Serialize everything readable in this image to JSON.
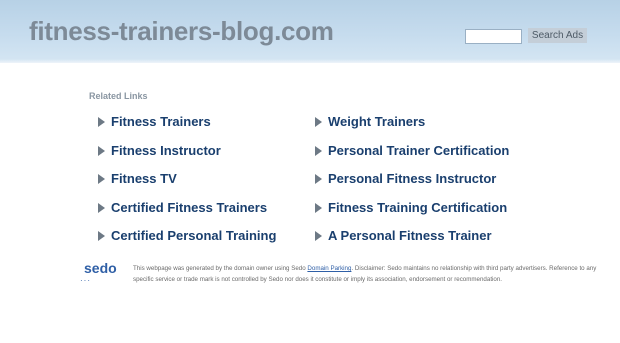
{
  "header": {
    "site_title": "fitness-trainers-blog.com",
    "search_placeholder": "",
    "search_button": "Search Ads"
  },
  "related": {
    "heading": "Related Links",
    "left": [
      "Fitness Trainers",
      "Fitness Instructor",
      "Fitness TV",
      "Certified Fitness Trainers",
      "Certified Personal Training"
    ],
    "right": [
      "Weight Trainers",
      "Personal Trainer Certification",
      "Personal Fitness Instructor",
      "Fitness Training Certification",
      "A Personal Fitness Trainer"
    ]
  },
  "footer": {
    "logo_text": "sedo",
    "disclaimer_before": "This webpage was generated by the domain owner using Sedo ",
    "disclaimer_link": "Domain Parking",
    "disclaimer_after": ". Disclaimer: Sedo maintains no relationship with third party advertisers. Reference to any specific service or trade mark is not controlled by Sedo nor does it constitute or imply its association, endorsement or recommendation."
  },
  "colors": {
    "header_bg": "#c6dcee",
    "title": "#7d8a97",
    "link": "#1a3f6e",
    "arrow": "#6d7985",
    "brand": "#2f5fa6"
  }
}
